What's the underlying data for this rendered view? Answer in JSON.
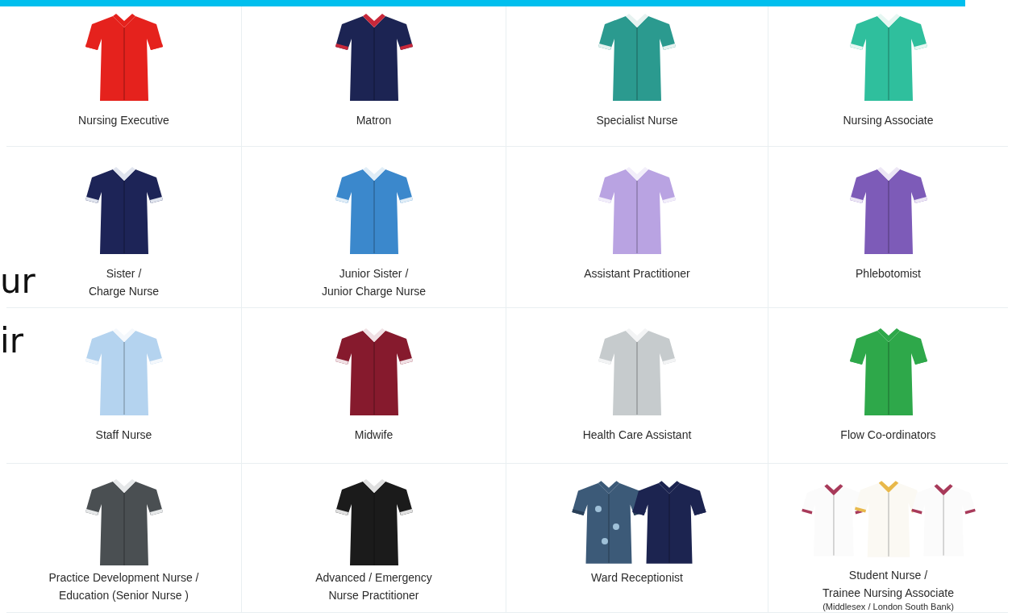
{
  "uniforms": [
    {
      "label": "Nursing Executive"
    },
    {
      "label": "Matron"
    },
    {
      "label": "Specialist Nurse"
    },
    {
      "label": "Nursing Associate"
    },
    {
      "label": "Sister /\nCharge Nurse"
    },
    {
      "label": "Junior Sister /\nJunior Charge Nurse"
    },
    {
      "label": "Assistant Practitioner"
    },
    {
      "label": "Phlebotomist"
    },
    {
      "label": "Staff Nurse"
    },
    {
      "label": "Midwife"
    },
    {
      "label": "Health Care Assistant"
    },
    {
      "label": "Flow Co-ordinators"
    },
    {
      "label": "Practice Development Nurse /\nEducation (Senior Nurse )"
    },
    {
      "label": "Advanced / Emergency\nNurse Practitioner"
    },
    {
      "label": "Ward Receptionist"
    },
    {
      "label": "Student Nurse /\nTrainee Nursing Associate",
      "note": "(Middlesex / London South Bank)"
    }
  ],
  "background_text": [
    "ur",
    "ir"
  ]
}
